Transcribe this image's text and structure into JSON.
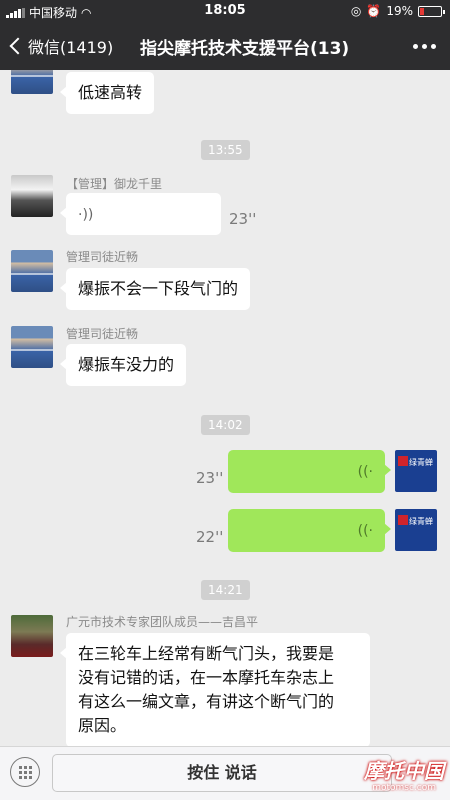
{
  "status": {
    "carrier": "中国移动",
    "time": "18:05",
    "battery": "19%",
    "battery_level": 0.19
  },
  "nav": {
    "back_label": "微信(1419)",
    "title": "指尖摩托技术支援平台(13)"
  },
  "messages": {
    "m0_text": "低速高转",
    "ts1": "13:55",
    "m1_name": "【管理】御龙千里",
    "m1_duration": "23''",
    "m2_name": "管理司徒近畅",
    "m2_text": "爆振不会一下段气门的",
    "m3_name": "管理司徒近畅",
    "m3_text": "爆振车没力的",
    "ts2": "14:02",
    "m4_duration": "23''",
    "m5_duration": "22''",
    "ts3": "14:21",
    "m6_name": "广元市技术专家团队成员——吉昌平",
    "m6_line1": "在三轮车上经常有断气门头，我要是",
    "m6_line2": "没有记错的话，在一本摩托车杂志上",
    "m6_line3": "有这么一编文章，有讲这个断气门的",
    "m6_line4": "原因。"
  },
  "input": {
    "hold_label": "按住 说话"
  },
  "watermark": {
    "title": "摩托中国",
    "site": "motomsc.com"
  },
  "avatar_self_text": "绿青蝉",
  "icons": [
    "signal-icon",
    "wifi-icon",
    "battery-icon",
    "back-chevron-icon",
    "more-icon",
    "voice-wave-icon",
    "keyboard-icon"
  ],
  "colors": {
    "bar": "#2d2d2f",
    "chat_bg": "#ececec",
    "bubble_green": "#a0e75a"
  }
}
